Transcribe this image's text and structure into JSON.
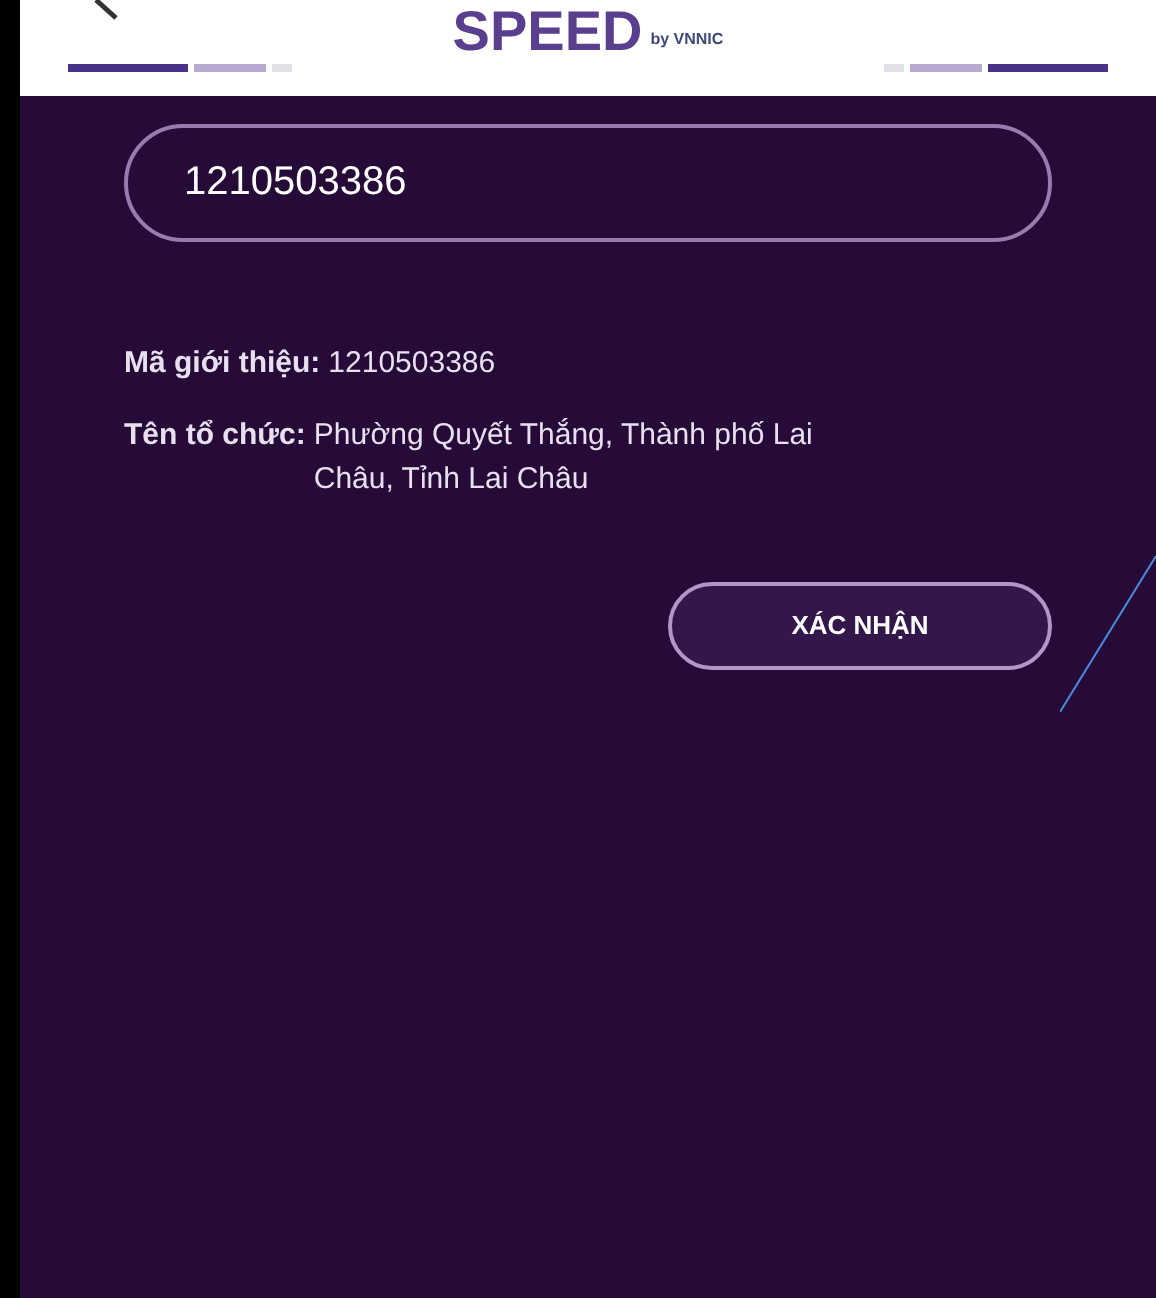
{
  "header": {
    "logo": "SPEED",
    "logo_suffix": "by VNNIC"
  },
  "code_field": {
    "value": "1210503386"
  },
  "details": [
    {
      "label": "Mã giới thiệu:",
      "value": "1210503386"
    },
    {
      "label": "Tên tổ chức:",
      "value": "Phường Quyết Thắng, Thành phố Lai Châu, Tỉnh Lai Châu"
    }
  ],
  "confirm_button": {
    "label": "XÁC NHẬN"
  }
}
